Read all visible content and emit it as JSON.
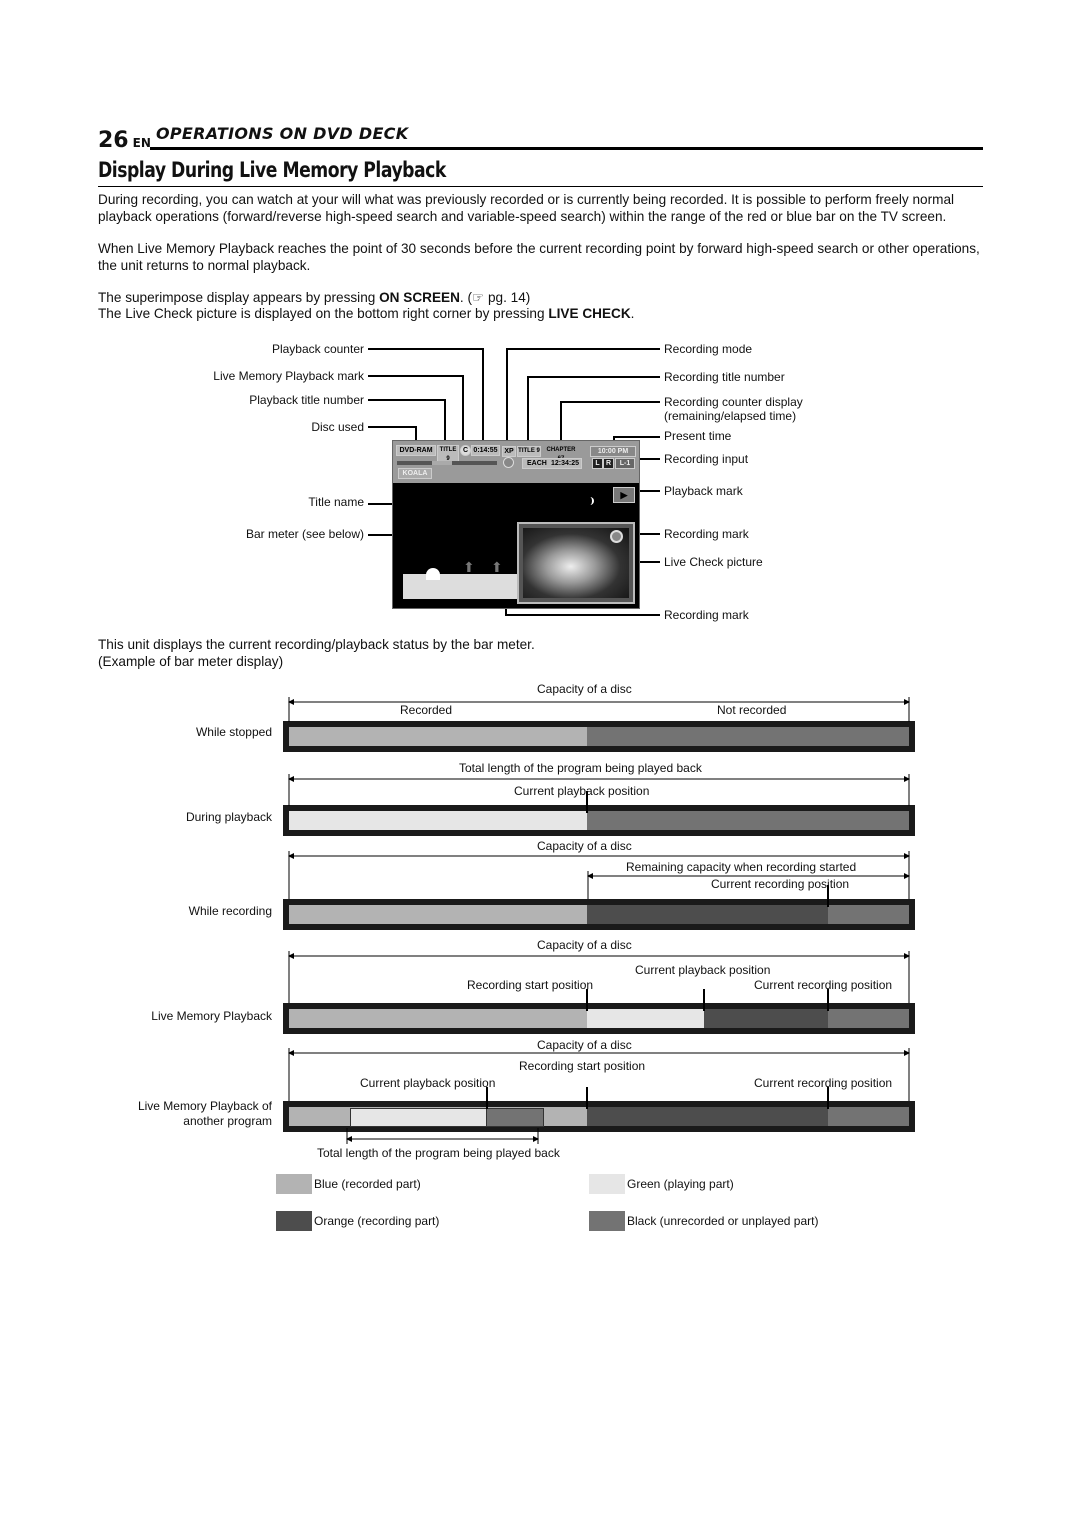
{
  "header": {
    "page_number": "26",
    "lang": "EN",
    "section": "OPERATIONS ON DVD DECK",
    "title": "Display During Live Memory Playback"
  },
  "intro": {
    "p1": "During recording, you can watch at your will what was previously recorded or is currently being recorded. It is possible to perform freely normal playback operations (forward/reverse high-speed search and variable-speed search) within the range of the red or blue bar on the TV screen.",
    "p2": "When Live Memory Playback reaches the point of 30 seconds before the current recording point by forward high-speed search or other operations, the unit returns to normal playback.",
    "p3_pre": "The superimpose display appears by pressing ",
    "p3_bold": "ON SCREEN",
    "p3_post": ". (☞ pg. 14)",
    "p4_pre": "The Live Check picture is displayed on the bottom right corner by pressing ",
    "p4_bold": "LIVE CHECK",
    "p4_post": "."
  },
  "screen_diagram": {
    "left_labels": [
      "Playback counter",
      "Live Memory Playback mark",
      "Playback title number",
      "Disc used",
      "Title name",
      "Bar meter (see below)"
    ],
    "right_labels": [
      "Recording mode",
      "Recording title number",
      "Recording counter display",
      "(remaining/elapsed time)",
      "Present time",
      "Recording input",
      "Playback mark",
      "Recording mark",
      "Live Check picture",
      "Recording mark"
    ],
    "tv": {
      "disc": "DVD-RAM",
      "play_title": "TITLE 9",
      "live_mark": "C",
      "play_counter": "0:14:55",
      "rec_mode": "XP",
      "rec_title": "TITLE 9",
      "chapter": "CHAPTER 67",
      "each": "EACH",
      "rec_counter": "12:34:25",
      "present_time": "10:00 PM",
      "audio_l": "L",
      "audio_r": "R",
      "rec_input": "L-1",
      "title_name": "KOALA",
      "play_mark": "▶"
    }
  },
  "bar_intro": {
    "line1": "This unit displays the current recording/playback status by the bar meter.",
    "line2": "(Example of bar meter display)"
  },
  "chart_data": {
    "type": "bar",
    "title": "Example of bar meter display",
    "scale": "fraction of disc capacity (0–1)",
    "colors": {
      "blue": "#b3b3b3",
      "green": "#e6e6e6",
      "orange": "#4d4d4d",
      "black": "#737373"
    },
    "rows": [
      {
        "label": "While stopped",
        "annotations": [
          "Capacity of a disc",
          "Recorded",
          "Not recorded"
        ],
        "segments": [
          {
            "kind": "blue",
            "from": 0,
            "to": 0.48
          },
          {
            "kind": "black",
            "from": 0.48,
            "to": 1
          }
        ],
        "markers": []
      },
      {
        "label": "During playback",
        "annotations": [
          "Total length of the program being played back",
          "Current playback position"
        ],
        "segments": [
          {
            "kind": "green",
            "from": 0,
            "to": 0.48
          },
          {
            "kind": "black",
            "from": 0.48,
            "to": 1
          }
        ],
        "markers": [
          0.48
        ]
      },
      {
        "label": "While recording",
        "annotations": [
          "Capacity of a disc",
          "Remaining capacity when recording started",
          "Current recording position"
        ],
        "segments": [
          {
            "kind": "blue",
            "from": 0,
            "to": 0.48
          },
          {
            "kind": "orange",
            "from": 0.48,
            "to": 0.87
          },
          {
            "kind": "black",
            "from": 0.87,
            "to": 1
          }
        ],
        "markers": [
          0.87
        ]
      },
      {
        "label": "Live Memory Playback",
        "annotations": [
          "Capacity of a disc",
          "Current playback position",
          "Recording start position",
          "Current recording position"
        ],
        "segments": [
          {
            "kind": "blue",
            "from": 0,
            "to": 0.48
          },
          {
            "kind": "green",
            "from": 0.48,
            "to": 0.67
          },
          {
            "kind": "orange",
            "from": 0.67,
            "to": 0.87
          },
          {
            "kind": "black",
            "from": 0.87,
            "to": 1
          }
        ],
        "markers": [
          0.48,
          0.67,
          0.87
        ]
      },
      {
        "label": "Live Memory Playback of another program",
        "label_lines": [
          "Live Memory Playback of",
          "another program"
        ],
        "annotations": [
          "Capacity of a disc",
          "Recording start position",
          "Current playback position",
          "Current recording position",
          "Total length of the program being played back"
        ],
        "segments": [
          {
            "kind": "blue",
            "from": 0,
            "to": 0.48
          },
          {
            "kind": "orange",
            "from": 0.48,
            "to": 0.87
          },
          {
            "kind": "black",
            "from": 0.87,
            "to": 1
          }
        ],
        "inner_segments": [
          {
            "kind": "green",
            "from": 0.1,
            "to": 0.32
          },
          {
            "kind": "black",
            "from": 0.32,
            "to": 0.41
          }
        ],
        "markers": [
          0.32,
          0.48,
          0.87
        ]
      }
    ],
    "legend": [
      {
        "kind": "blue",
        "label": "Blue (recorded part)"
      },
      {
        "kind": "green",
        "label": "Green (playing part)"
      },
      {
        "kind": "orange",
        "label": "Orange (recording part)"
      },
      {
        "kind": "black",
        "label": "Black (unrecorded or unplayed part)"
      }
    ]
  }
}
